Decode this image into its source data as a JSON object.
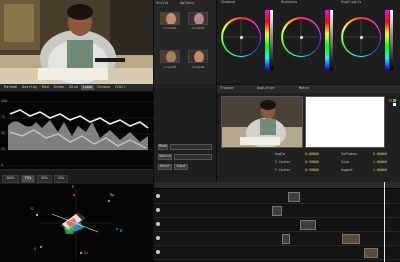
{
  "scopes": {
    "tabs": [
      "Parade",
      "Overlay",
      "Red",
      "Green",
      "Blue",
      "Luma",
      "Chroma",
      "YCbCr"
    ],
    "active_tab": "Luma",
    "vs_tabs": [
      "100%",
      "75%",
      "50%",
      "25%"
    ],
    "vs_active": "75%",
    "waveform_labels": [
      "100",
      "75",
      "50",
      "25",
      "0"
    ],
    "vector_labels": {
      "r": "R",
      "mg": "Mg",
      "b": "B",
      "cy": "Cy",
      "g": "G",
      "yl": "Yl"
    }
  },
  "gallery": {
    "tabs": [
      "Stills",
      "Gallery"
    ],
    "thumbnails": [
      "Grade01",
      "Grade02",
      "Grade03",
      "Grade04"
    ]
  },
  "wheels": {
    "headers": [
      "Shadows",
      "Midtones",
      "Highlights"
    ]
  },
  "preview": {
    "tabs": [
      "Tracker",
      "Qualifier",
      "Matte"
    ],
    "info_rows": [
      {
        "label": "Angle",
        "value": "0.00000",
        "label2": "Softness",
        "value2": "0.00000"
      },
      {
        "label": "X Center",
        "value": "0.50000",
        "label2": "Size",
        "value2": "1.00000"
      },
      {
        "label": "Y Center",
        "value": "0.50000",
        "label2": "Aspect",
        "value2": "1.00000"
      }
    ]
  },
  "controls": {
    "mode_label": "Mode",
    "source_label": "Source",
    "reset_label": "Reset",
    "input_label": "Input"
  },
  "timeline": {
    "tracks": 5,
    "clips": [
      {
        "track": 0,
        "label": ""
      },
      {
        "track": 1,
        "label": ""
      },
      {
        "track": 2,
        "label": ""
      },
      {
        "track": 3,
        "label": ""
      },
      {
        "track": 3,
        "label": ""
      },
      {
        "track": 4,
        "label": ""
      }
    ]
  }
}
